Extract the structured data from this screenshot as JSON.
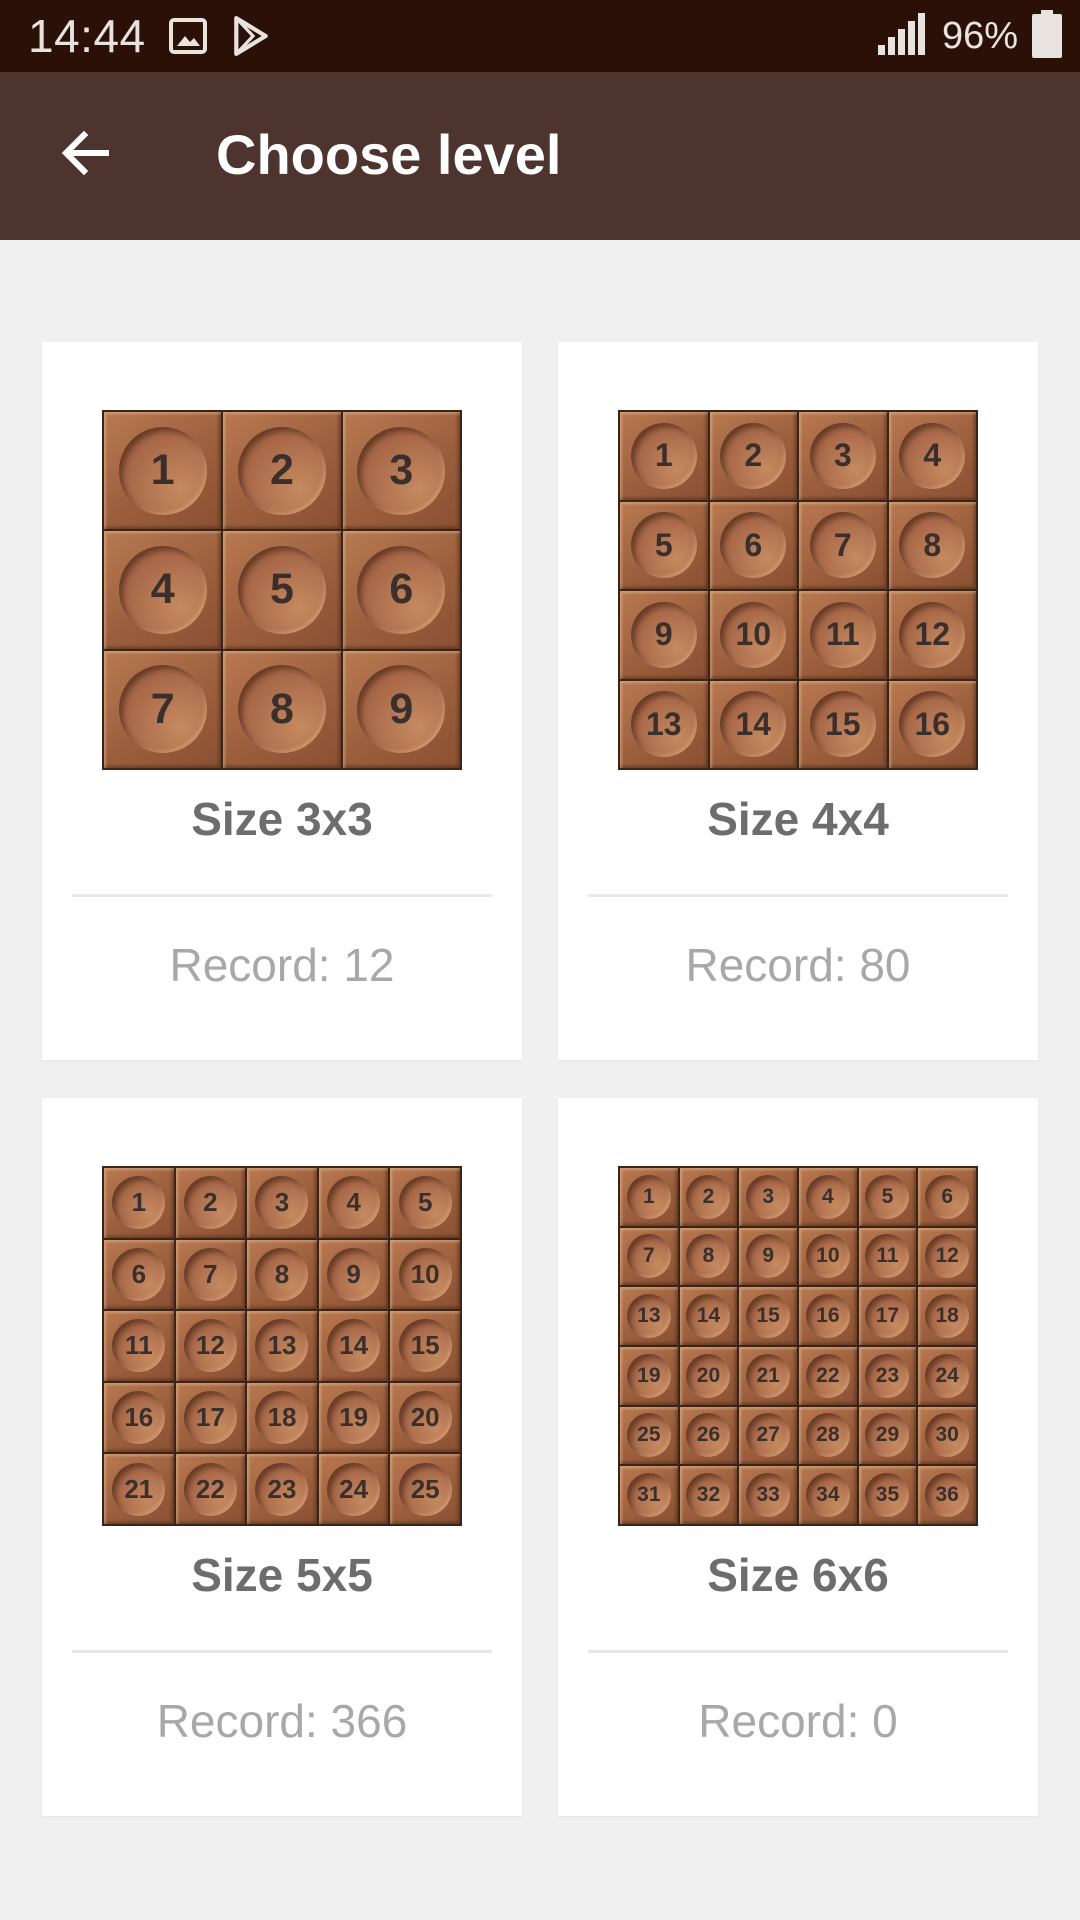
{
  "status": {
    "time": "14:44",
    "battery": "96%",
    "icons": [
      "image-icon",
      "play-store-icon",
      "signal-icon",
      "battery-icon"
    ]
  },
  "app_bar": {
    "title": "Choose level",
    "back_icon": "back-arrow-icon"
  },
  "levels": [
    {
      "label": "Size 3x3",
      "record": "Record: 12",
      "size": 3
    },
    {
      "label": "Size 4x4",
      "record": "Record: 80",
      "size": 4
    },
    {
      "label": "Size 5x5",
      "record": "Record: 366",
      "size": 5
    },
    {
      "label": "Size 6x6",
      "record": "Record: 0",
      "size": 6
    }
  ],
  "colors": {
    "status_bar": "#2a1006",
    "app_bar": "#4e342e",
    "tile": "#9c5f3d",
    "background": "#f1f0f1"
  }
}
